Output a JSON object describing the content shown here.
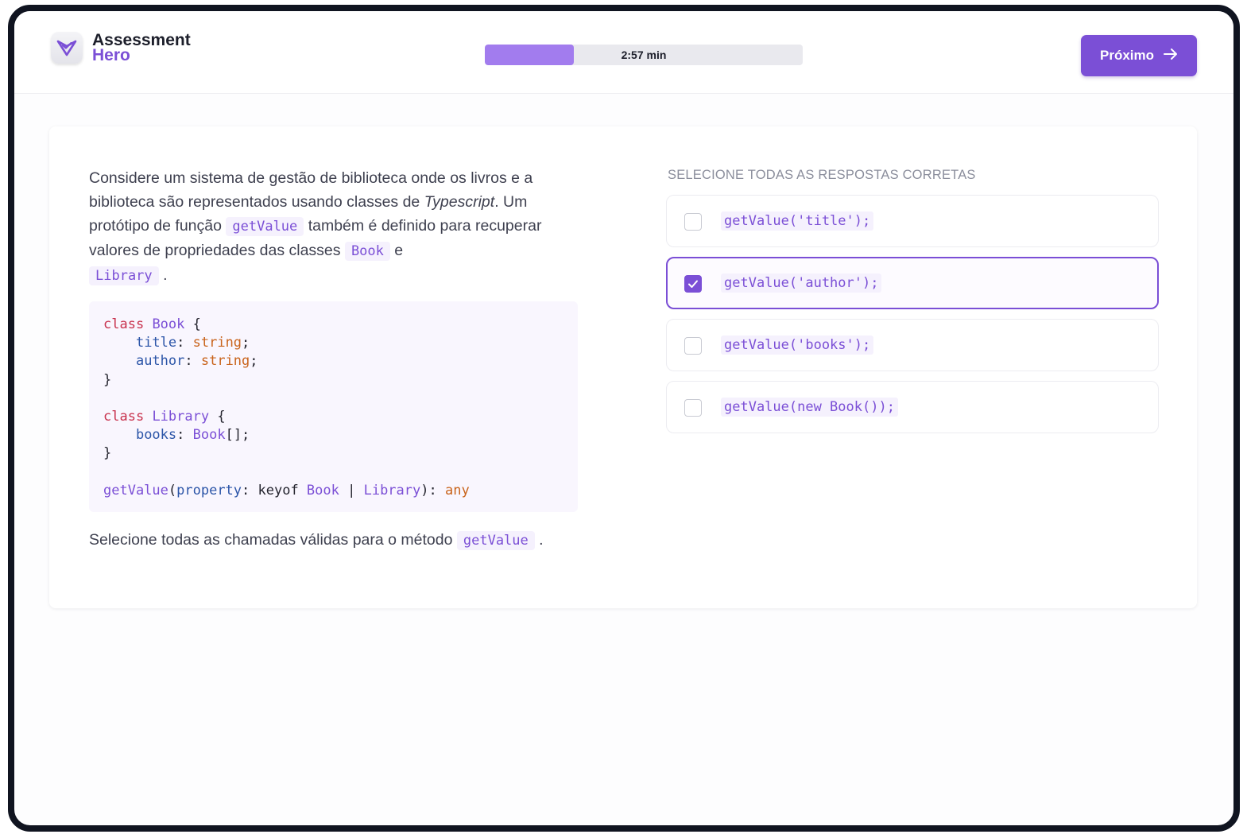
{
  "app": {
    "brand_line1": "Assessment",
    "brand_line2": "Hero",
    "accent_color": "#7b4fd6"
  },
  "timer": {
    "label": "2:57 min",
    "progress_fraction": 0.28
  },
  "header": {
    "next_label": "Próximo",
    "next_icon": "arrow-right-icon"
  },
  "question": {
    "p1": "Considere um sistema de gestão de biblioteca onde os livros e a biblioteca são representados usando classes de ",
    "p1_italic": "Typescript",
    "p2": ". Um protótipo de função ",
    "code_getvalue": "getValue",
    "p3": " também é definido para recuperar valores de propriedades das classes ",
    "code_book": "Book",
    "p4": " e ",
    "code_library": "Library",
    "p5": " .",
    "footer_text": "Selecione todas as chamadas válidas para o método ",
    "footer_code": "getValue",
    "footer_end": " ."
  },
  "code": {
    "l1_kw": "class",
    "l1_cls": "Book",
    "l1_rest": " {",
    "l2_prop": "title",
    "l2_sep": ": ",
    "l2_type": "string",
    "l2_end": ";",
    "l3_prop": "author",
    "l3_sep": ": ",
    "l3_type": "string",
    "l3_end": ";",
    "l4": "}",
    "l6_kw": "class",
    "l6_cls": "Library",
    "l6_rest": " {",
    "l7_prop": "books",
    "l7_sep": ": ",
    "l7_cls": "Book",
    "l7_end": "[];",
    "l8": "}",
    "l10_fn": "getValue",
    "l10_paren": "(",
    "l10_param": "property",
    "l10_sep": ": keyof ",
    "l10_cls1": "Book",
    "l10_pipe": " | ",
    "l10_cls2": "Library",
    "l10_close": "): ",
    "l10_type": "any"
  },
  "answers": {
    "label": "SELECIONE TODAS AS RESPOSTAS CORRETAS",
    "options": [
      {
        "code": "getValue('title');",
        "checked": false
      },
      {
        "code": "getValue('author');",
        "checked": true
      },
      {
        "code": "getValue('books');",
        "checked": false
      },
      {
        "code": "getValue(new Book());",
        "checked": false
      }
    ]
  }
}
